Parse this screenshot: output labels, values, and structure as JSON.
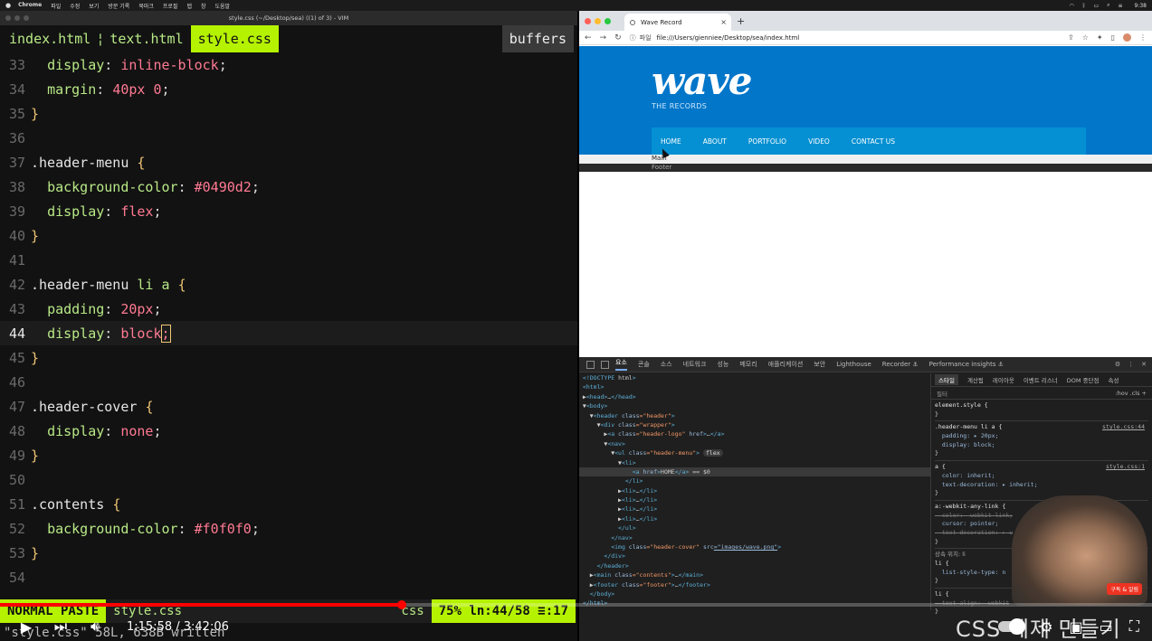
{
  "menubar": {
    "apple": "",
    "items": [
      "Chrome",
      "파일",
      "수정",
      "보기",
      "방문 기록",
      "북마크",
      "프로필",
      "탭",
      "창",
      "도움말"
    ],
    "clock": "9:38"
  },
  "vim": {
    "title": "style.css (~/Desktop/sea) ((1) of 3) - VIM",
    "tabs": [
      "index.html",
      "text.html",
      "style.css"
    ],
    "tab_separator": "¦",
    "buffers_label": "buffers",
    "lines": [
      {
        "n": "33",
        "segments": [
          [
            "ind",
            "  "
          ],
          [
            "p",
            "display"
          ],
          [
            "t",
            ": "
          ],
          [
            "v",
            "inline-block"
          ],
          [
            "t",
            ";"
          ]
        ]
      },
      {
        "n": "34",
        "segments": [
          [
            "ind",
            "  "
          ],
          [
            "p",
            "margin"
          ],
          [
            "t",
            ": "
          ],
          [
            "v",
            "40px 0"
          ],
          [
            "t",
            ";"
          ]
        ]
      },
      {
        "n": "35",
        "segments": [
          [
            "b",
            "}"
          ]
        ]
      },
      {
        "n": "36",
        "segments": []
      },
      {
        "n": "37",
        "segments": [
          [
            "s",
            ".header-menu "
          ],
          [
            "b",
            "{"
          ]
        ]
      },
      {
        "n": "38",
        "segments": [
          [
            "ind",
            "  "
          ],
          [
            "p",
            "background-color"
          ],
          [
            "t",
            ": "
          ],
          [
            "v",
            "#0490d2"
          ],
          [
            "t",
            ";"
          ]
        ]
      },
      {
        "n": "39",
        "segments": [
          [
            "ind",
            "  "
          ],
          [
            "p",
            "display"
          ],
          [
            "t",
            ": "
          ],
          [
            "v",
            "flex"
          ],
          [
            "t",
            ";"
          ]
        ]
      },
      {
        "n": "40",
        "segments": [
          [
            "b",
            "}"
          ]
        ]
      },
      {
        "n": "41",
        "segments": []
      },
      {
        "n": "42",
        "segments": [
          [
            "s",
            ".header-menu "
          ],
          [
            "p",
            "li a "
          ],
          [
            "b",
            "{"
          ]
        ]
      },
      {
        "n": "43",
        "segments": [
          [
            "ind",
            "  "
          ],
          [
            "p",
            "padding"
          ],
          [
            "t",
            ": "
          ],
          [
            "v",
            "20px"
          ],
          [
            "t",
            ";"
          ]
        ]
      },
      {
        "n": "44",
        "segments": [
          [
            "ind",
            "  "
          ],
          [
            "p",
            "display"
          ],
          [
            "t",
            ": "
          ],
          [
            "v",
            "block"
          ],
          [
            "c",
            ";"
          ]
        ],
        "current": true
      },
      {
        "n": "45",
        "segments": [
          [
            "b",
            "}"
          ]
        ]
      },
      {
        "n": "46",
        "segments": []
      },
      {
        "n": "47",
        "segments": [
          [
            "s",
            ".header-cover "
          ],
          [
            "b",
            "{"
          ]
        ]
      },
      {
        "n": "48",
        "segments": [
          [
            "ind",
            "  "
          ],
          [
            "p",
            "display"
          ],
          [
            "t",
            ": "
          ],
          [
            "v",
            "none"
          ],
          [
            "t",
            ";"
          ]
        ]
      },
      {
        "n": "49",
        "segments": [
          [
            "b",
            "}"
          ]
        ]
      },
      {
        "n": "50",
        "segments": []
      },
      {
        "n": "51",
        "segments": [
          [
            "s",
            ".contents "
          ],
          [
            "b",
            "{"
          ]
        ]
      },
      {
        "n": "52",
        "segments": [
          [
            "ind",
            "  "
          ],
          [
            "p",
            "background-color"
          ],
          [
            "t",
            ": "
          ],
          [
            "v",
            "#f0f0f0"
          ],
          [
            "t",
            ";"
          ]
        ]
      },
      {
        "n": "53",
        "segments": [
          [
            "b",
            "}"
          ]
        ]
      },
      {
        "n": "54",
        "segments": []
      }
    ],
    "status": {
      "mode": "NORMAL  PASTE",
      "file": "style.css",
      "filetype": "css",
      "position": "75%  ln:44/58 ≡:17"
    },
    "cmdline": "\"style.css\" 58L, 638B written"
  },
  "chrome": {
    "tab_title": "Wave Record",
    "close": "×",
    "new_tab": "+",
    "url_prefix": "파일",
    "url": "file:///Users/gienniee/Desktop/sea/index.html"
  },
  "site": {
    "logo": "wave",
    "subtitle": "THE RECORDS",
    "menu": [
      "HOME",
      "ABOUT",
      "PORTFOLIO",
      "VIDEO",
      "CONTACT US"
    ],
    "main": "Main",
    "footer": "Footer"
  },
  "devtools": {
    "tabs": [
      "요소",
      "콘솔",
      "소스",
      "네트워크",
      "성능",
      "메모리",
      "애플리케이션",
      "보안",
      "Lighthouse",
      "Recorder ⚓",
      "Performance insights ⚓"
    ],
    "active_tab": "요소",
    "dom": [
      {
        "html": "<!DOCTYPE html>"
      },
      {
        "html": "<html>"
      },
      {
        "html": "▶<head>…</head>"
      },
      {
        "html": "▼<body>"
      },
      {
        "html": "  ▼<header class=\"header\">"
      },
      {
        "html": "    ▼<div class=\"wrapper\">"
      },
      {
        "html": "      ▶<a class=\"header-logo\" href>…</a>"
      },
      {
        "html": "      ▼<nav>"
      },
      {
        "html": "        ▼<ul class=\"header-menu\">",
        "badge": "flex"
      },
      {
        "html": "          ▼<li>"
      },
      {
        "html": "              <a href>HOME</a> == $0",
        "selected": true
      },
      {
        "html": "            </li>"
      },
      {
        "html": "          ▶<li>…</li>"
      },
      {
        "html": "          ▶<li>…</li>"
      },
      {
        "html": "          ▶<li>…</li>"
      },
      {
        "html": "          ▶<li>…</li>"
      },
      {
        "html": "          </ul>"
      },
      {
        "html": "        </nav>"
      },
      {
        "html": "        <img class=\"header-cover\" src=\"images/wave.png\">"
      },
      {
        "html": "      </div>"
      },
      {
        "html": "    </header>"
      },
      {
        "html": "  ▶<main class=\"contents\">…</main>"
      },
      {
        "html": "  ▶<footer class=\"footer\">…</footer>"
      },
      {
        "html": "  </body>"
      },
      {
        "html": "</html>"
      }
    ],
    "style_tabs": [
      "스타일",
      "계산됨",
      "레이아웃",
      "이벤트 리스너",
      "DOM 중단점",
      "속성"
    ],
    "filter": "필터",
    "filter_right": ":hov  .cls  +",
    "styles": [
      {
        "t": "element.style {",
        "k": "sel"
      },
      {
        "t": "}",
        "k": "plain"
      },
      {
        "t": "sep"
      },
      {
        "t": ".header-menu li a {",
        "k": "sel",
        "src": "style.css:44"
      },
      {
        "t": "  padding: ▸ 20px;",
        "k": "prop"
      },
      {
        "t": "  display: block;",
        "k": "prop"
      },
      {
        "t": "}",
        "k": "plain"
      },
      {
        "t": "sep"
      },
      {
        "t": "a {",
        "k": "sel",
        "src": "style.css:1"
      },
      {
        "t": "  color: inherit;",
        "k": "prop"
      },
      {
        "t": "  text-decoration: ▸ inherit;",
        "k": "prop"
      },
      {
        "t": "}",
        "k": "plain"
      },
      {
        "t": "sep"
      },
      {
        "t": "a:-webkit-any-link {",
        "k": "sel"
      },
      {
        "t": "  color: -webkit-link;",
        "k": "strike"
      },
      {
        "t": "  cursor: pointer;",
        "k": "prop"
      },
      {
        "t": "  text-decoration: ▸ u",
        "k": "strike"
      },
      {
        "t": "}",
        "k": "plain"
      },
      {
        "t": "sep"
      },
      {
        "t": "상속 위치: li",
        "k": "inherit"
      },
      {
        "t": "li {",
        "k": "sel"
      },
      {
        "t": "  list-style-type: n",
        "k": "prop"
      },
      {
        "t": "}",
        "k": "plain"
      },
      {
        "t": "sep"
      },
      {
        "t": "li {",
        "k": "sel"
      },
      {
        "t": "  text-align: -webkit",
        "k": "strike"
      },
      {
        "t": "}",
        "k": "plain"
      }
    ]
  },
  "webcam": {
    "badge": "구독 & 알림"
  },
  "player": {
    "time": "1:15:58 / 3:42:06",
    "progress_fraction": 0.349,
    "watermark": "CSS 예제 만들기"
  },
  "colors": {
    "accent": "#b5f200",
    "site_header": "#0276c9",
    "site_menu": "#0490d2",
    "progress": "#ff0000"
  }
}
